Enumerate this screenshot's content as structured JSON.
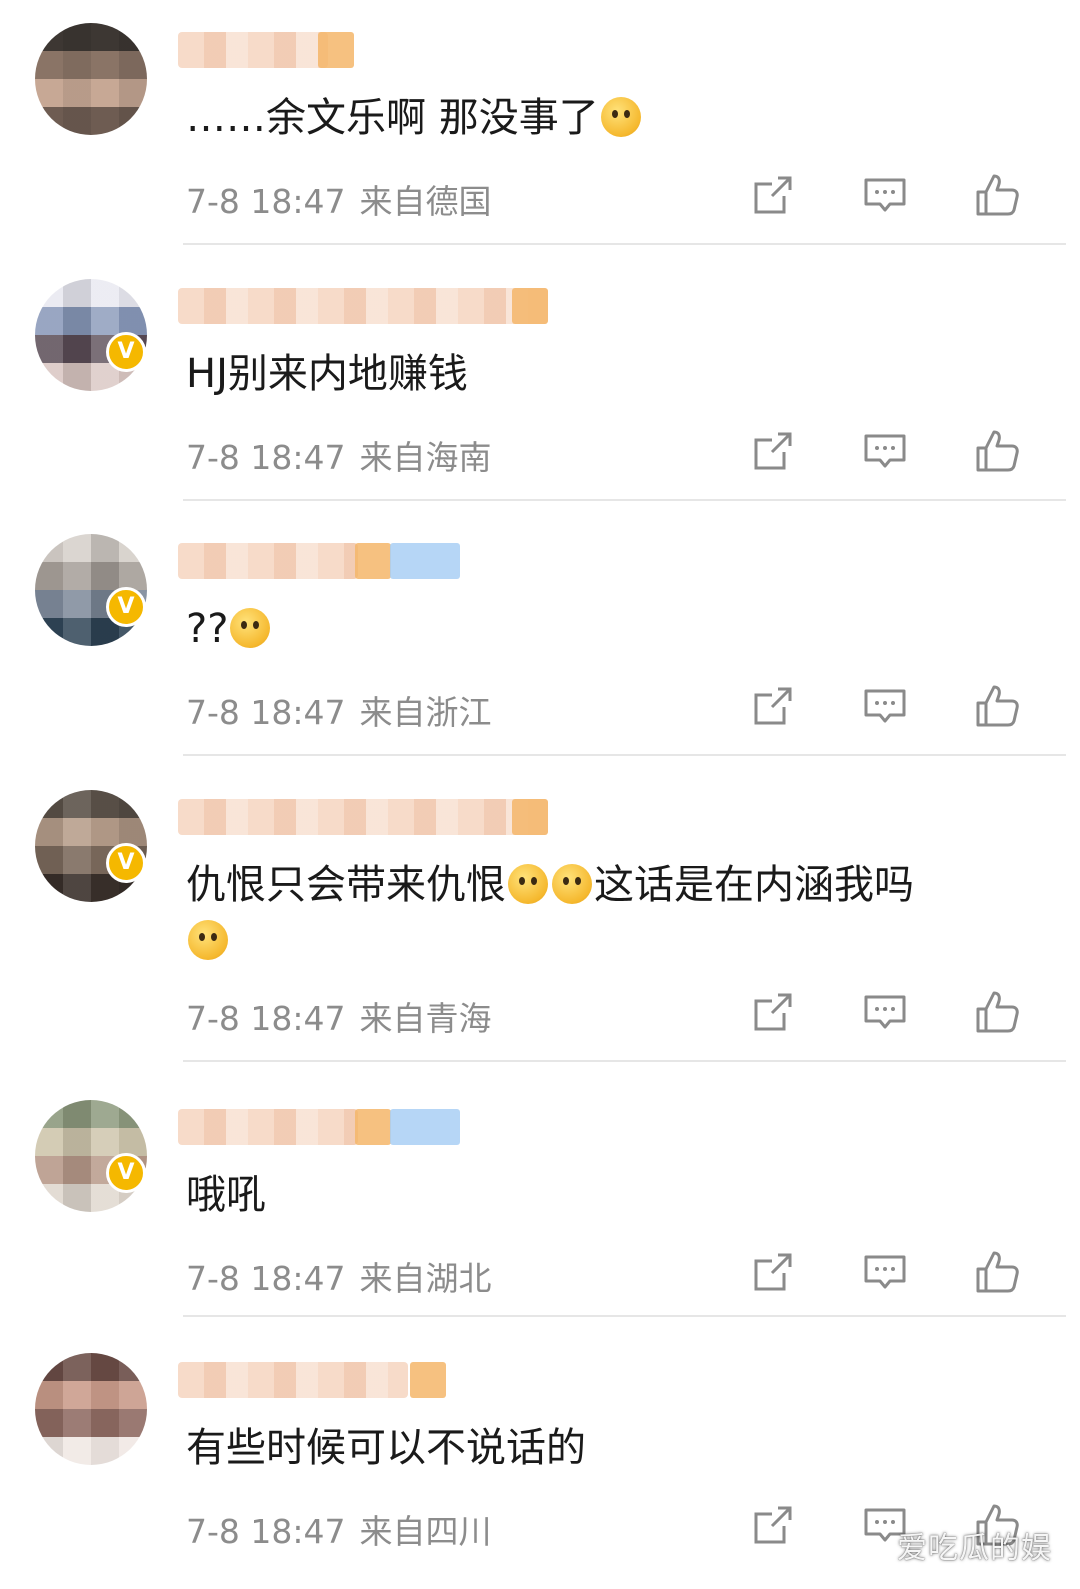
{
  "comments": [
    {
      "text": "……余文乐啊 那没事了",
      "time": "7-8 18:47",
      "location": "来自德国",
      "verified": false,
      "emojis": [
        "crying-emoji"
      ]
    },
    {
      "text": "HJ别来内地赚钱",
      "time": "7-8 18:47",
      "location": "来自海南",
      "verified": true,
      "emojis": []
    },
    {
      "text": "??",
      "time": "7-8 18:47",
      "location": "来自浙江",
      "verified": true,
      "emojis": [
        "confused-emoji"
      ]
    },
    {
      "text_a": "仇恨只会带来仇恨",
      "text_b": "这话是在内涵我吗",
      "time": "7-8 18:47",
      "location": "来自青海",
      "verified": true,
      "emojis": [
        "thinking-emoji",
        "thinking-emoji",
        "smile-emoji"
      ]
    },
    {
      "text": "哦吼",
      "time": "7-8 18:47",
      "location": "来自湖北",
      "verified": true,
      "emojis": []
    },
    {
      "text": "有些时候可以不说话的",
      "time": "7-8 18:47",
      "location": "来自四川",
      "verified": false,
      "emojis": []
    }
  ],
  "badge_letter": "V",
  "watermark": "爱吃瓜的娱",
  "icons": {
    "repost": "repost-icon",
    "comment": "comment-icon",
    "like": "like-icon"
  },
  "colors": {
    "verified_badge": "#f5b800",
    "meta_text": "#8c8c8c",
    "divider": "#e6e6e6"
  }
}
